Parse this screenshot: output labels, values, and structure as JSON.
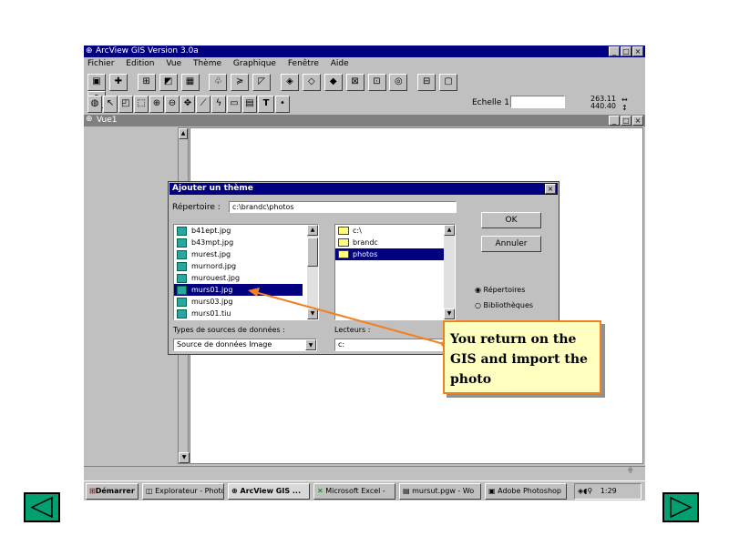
{
  "app": {
    "title": "ArcView GIS Version 3.0a",
    "scale_label": "Echelle 1:",
    "coord_x": "263.11",
    "coord_y": "440.40"
  },
  "menu": [
    "Fichier",
    "Edition",
    "Vue",
    "Thème",
    "Graphique",
    "Fenêtre",
    "Aide"
  ],
  "view": {
    "title": "Vue1"
  },
  "dialog": {
    "title": "Ajouter un thème",
    "dir_label": "Répertoire :",
    "dir_value": "c:\\brandc\\photos",
    "ok": "OK",
    "cancel": "Annuler",
    "files": [
      "b41ept.jpg",
      "b43mpt.jpg",
      "murest.jpg",
      "murnord.jpg",
      "murouest.jpg",
      "murs01.jpg",
      "murs03.jpg",
      "murs01.tiu"
    ],
    "selected_file": 5,
    "dirs": [
      "c:\\",
      "brandc",
      "photos"
    ],
    "types_label": "Types de sources de données :",
    "types_value": "Source de données Image",
    "drives_label": "Lecteurs :",
    "drives_value": "c:",
    "radio_dirs": "Répertoires",
    "radio_libs": "Bibliothèques"
  },
  "callout": "You return on the GIS and import the photo",
  "taskbar": {
    "start": "Démarrer",
    "items": [
      "Explorateur - Photo",
      "ArcView GIS ...",
      "Microsoft Excel -",
      "mursut.pgw - Wo",
      "Adobe Photoshop"
    ],
    "clock": "1:29"
  },
  "colors": {
    "titlebar": "#000080",
    "callout_bg": "#ffffc0",
    "callout_border": "#f08020",
    "nav": "#00a070"
  }
}
